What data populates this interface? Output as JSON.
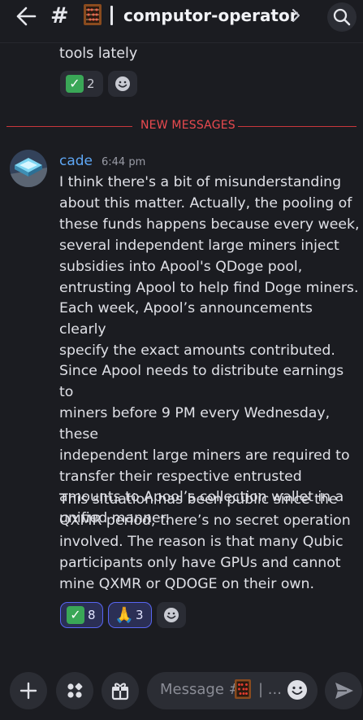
{
  "header": {
    "channel_name": "computor-operator"
  },
  "previous_message": {
    "text": "tools lately",
    "reactions": [
      {
        "emoji": "check-mark-emoji",
        "count": "2",
        "me": false
      }
    ]
  },
  "divider": {
    "label": "NEW MESSAGES"
  },
  "message": {
    "author": "cade",
    "timestamp": "6:44 pm",
    "paragraphs": [
      "I think there's a bit of misunderstanding\nabout this matter. Actually, the pooling of\nthese funds happens because every week,\nseveral independent large miners inject\nsubsidies into Apool's QDoge pool,\nentrusting Apool to help find Doge miners.\nEach week, Apool’s announcements clearly\nspecify the exact amounts contributed.",
      "Since Apool needs to distribute earnings to\nminers before 9 PM every Wednesday, these\nindependent large miners are required to\ntransfer their respective entrusted\namounts to Apool’s collection wallet in a\nunified manner.",
      "This situation has been public since the\nQXMR period; there’s no secret operation\ninvolved. The reason is that many Qubic\nparticipants only have GPUs and cannot\nmine QXMR or QDOGE on their own."
    ],
    "reactions": [
      {
        "emoji": "check-mark-emoji",
        "count": "8",
        "me": true
      },
      {
        "emoji": "folded-hands-emoji",
        "count": "3",
        "me": true
      }
    ]
  },
  "composer": {
    "placeholder_prefix": "Message #",
    "placeholder_suffix": "| ..."
  },
  "colors": {
    "background": "#1b1c21",
    "accent": "#5865f2",
    "new_messages": "#ea4a4f",
    "author": "#5ea7f5"
  }
}
